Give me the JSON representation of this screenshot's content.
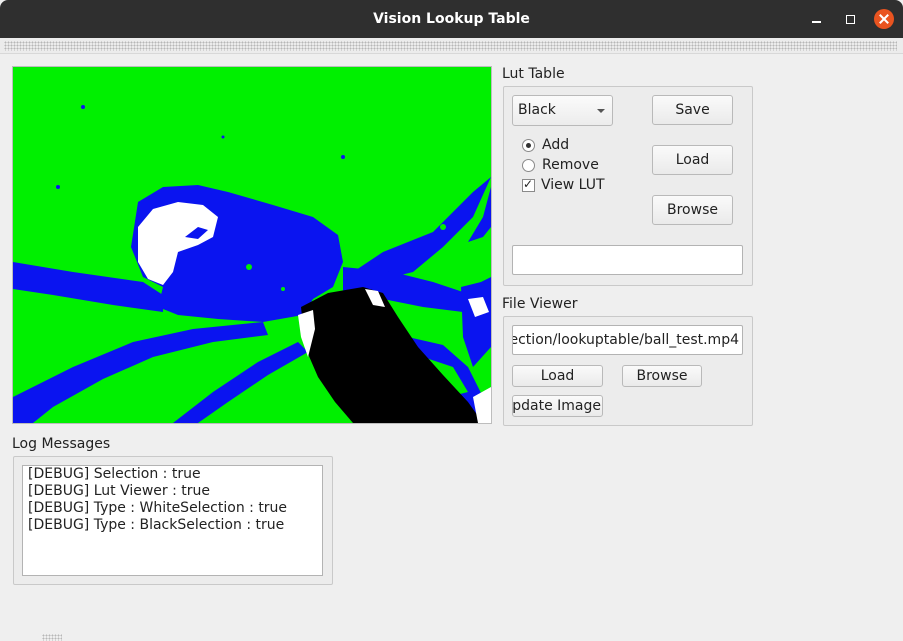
{
  "window": {
    "title": "Vision Lookup Table"
  },
  "lut_table": {
    "group_title": "Lut Table",
    "combo_value": "Black",
    "radio_add": "Add",
    "radio_remove": "Remove",
    "view_lut": "View LUT",
    "selected_mode": "Add",
    "view_lut_checked": true,
    "save_label": "Save",
    "load_label": "Load",
    "browse_label": "Browse",
    "path_value": ""
  },
  "file_viewer": {
    "group_title": "File Viewer",
    "path_value": "ection/lookuptable/ball_test.mp4",
    "load_label": "Load",
    "browse_label": "Browse",
    "update_label": "Update Image"
  },
  "log": {
    "group_title": "Log Messages",
    "lines": [
      "[DEBUG] Selection : true",
      "[DEBUG] Lut Viewer : true",
      "[DEBUG] Type : WhiteSelection : true",
      "[DEBUG] Type : BlackSelection : true"
    ]
  },
  "colors": {
    "field": "#00f000",
    "ball_region": "#0a14f0",
    "white_selection": "#ffffff",
    "black_selection": "#000000",
    "close_button": "#e95420"
  }
}
